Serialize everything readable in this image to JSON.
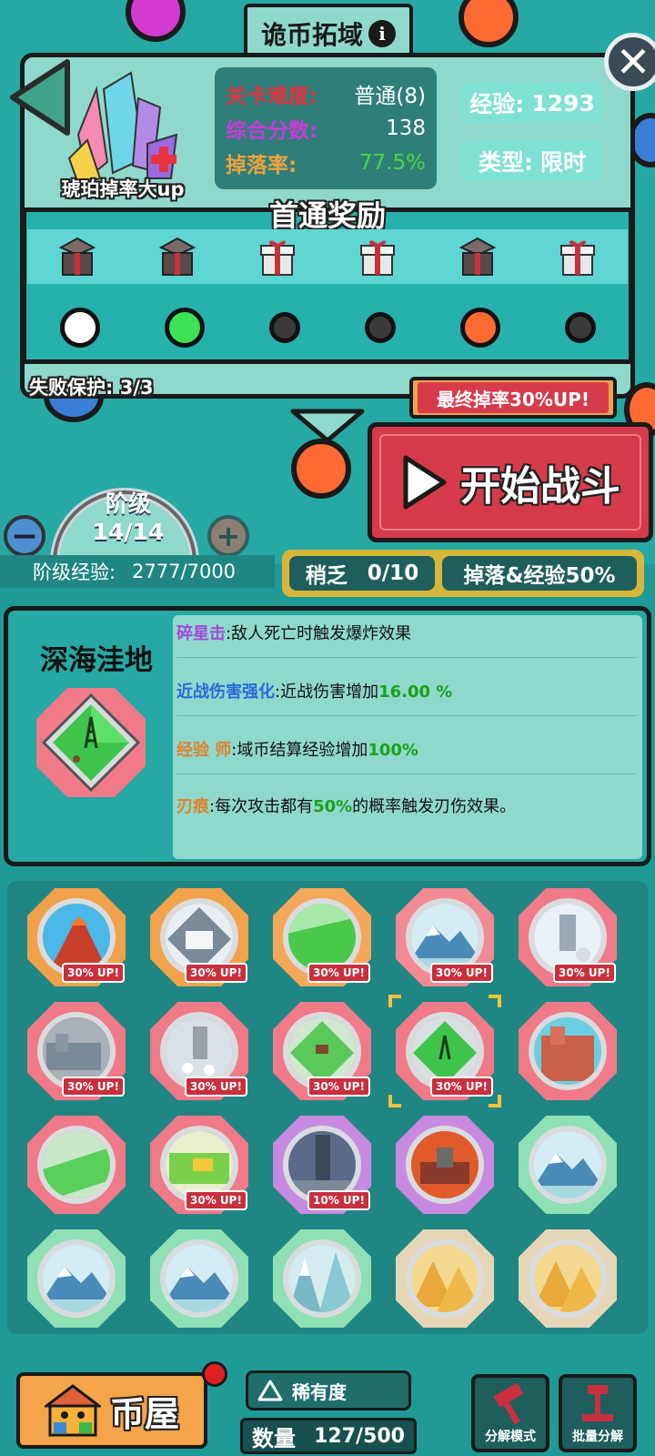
{
  "title": "诡币拓域",
  "amber_label": "琥珀掉率大up",
  "stats": [
    {
      "key": "关卡难度:",
      "value": "普通(8)",
      "key_color": "#e8323c",
      "value_color": "#ffffff"
    },
    {
      "key": "综合分数:",
      "value": "138",
      "key_color": "#c83bd8",
      "value_color": "#ffffff"
    },
    {
      "key": "掉落率:",
      "value": "77.5%",
      "key_color": "#f0a23a",
      "value_color": "#4cd83a"
    }
  ],
  "exp_chip": {
    "label": "经验:",
    "value": "1293"
  },
  "type_chip": {
    "label": "类型:",
    "value": "限时"
  },
  "reward_title": "首通奖励",
  "reward_icons": [
    "open-box",
    "open-box",
    "gift-box",
    "gift-box",
    "open-box",
    "gift-box"
  ],
  "reward_dots": [
    {
      "color": "#ffffff",
      "size": 44
    },
    {
      "color": "#3de356",
      "size": 44
    },
    {
      "color": "#3a3a3a",
      "size": 34
    },
    {
      "color": "#3a3a3a",
      "size": 34
    },
    {
      "color": "#ff6a33",
      "size": 44
    },
    {
      "color": "#3a3a3a",
      "size": 34
    }
  ],
  "fail_protect": "失败保护: 3/3",
  "drop_up_tag": "最终掉率30%UP!",
  "start_button": "开始战斗",
  "tier": {
    "label": "阶级",
    "value": "14/14",
    "minus": "−",
    "plus": "+"
  },
  "tier_exp": {
    "label": "阶级经验:",
    "value": "2777/7000"
  },
  "status": {
    "scarcity": "稍乏",
    "progress": "0/10",
    "bonus": "掉落&经验50%"
  },
  "map": {
    "name": "深海洼地"
  },
  "modifiers": [
    {
      "key": "碎星击",
      "key_color": "#a04cd8",
      "text": ":敌人死亡时触发爆炸效果",
      "green": "",
      "tail": ""
    },
    {
      "key": "近战伤害强化",
      "key_color": "#2a6ad8",
      "text": ":近战伤害增加",
      "green": "16.00 %",
      "tail": ""
    },
    {
      "key": "经验 师",
      "key_color": "#e0822a",
      "text": ":域币结算经验增加",
      "green": "100%",
      "tail": ""
    },
    {
      "key": "刃痕",
      "key_color": "#e0822a",
      "text": ":每次攻击都有",
      "green": "50%",
      "tail": "的概率触发刃伤效果。"
    }
  ],
  "tiles": [
    {
      "frame": "#f0a24a",
      "scene": "volcano",
      "badge": "30% UP!"
    },
    {
      "frame": "#f2a24a",
      "scene": "ice-diamond",
      "badge": "30% UP!"
    },
    {
      "frame": "#f5a75a",
      "scene": "grass-field",
      "badge": "30% UP!"
    },
    {
      "frame": "#f28a94",
      "scene": "snow-mountain",
      "badge": "30% UP!"
    },
    {
      "frame": "#f07a88",
      "scene": "snow-castle",
      "badge": "30% UP!"
    },
    {
      "frame": "#f07a88",
      "scene": "grey-town",
      "badge": "30% UP!"
    },
    {
      "frame": "#f07a88",
      "scene": "snow-tower",
      "badge": "30% UP!"
    },
    {
      "frame": "#f07a88",
      "scene": "grass-diamond",
      "badge": "30% UP!"
    },
    {
      "frame": "#f07a88",
      "scene": "deep-sea-diamond",
      "badge": "30% UP!",
      "selected": true
    },
    {
      "frame": "#f07a88",
      "scene": "red-canyon",
      "badge": ""
    },
    {
      "frame": "#f07a88",
      "scene": "green-path",
      "badge": ""
    },
    {
      "frame": "#f07a88",
      "scene": "farm",
      "badge": "30% UP!"
    },
    {
      "frame": "#c88ae0",
      "scene": "dark-tower",
      "badge": "10% UP!"
    },
    {
      "frame": "#c88ae0",
      "scene": "lava-castle",
      "badge": ""
    },
    {
      "frame": "#8fe0b4",
      "scene": "snow-mountain",
      "badge": ""
    },
    {
      "frame": "#8fe0b4",
      "scene": "snow-mountain",
      "badge": ""
    },
    {
      "frame": "#8fe0b4",
      "scene": "snow-mountain",
      "badge": ""
    },
    {
      "frame": "#8fe0b4",
      "scene": "ice-peaks",
      "badge": ""
    },
    {
      "frame": "#e6d6b8",
      "scene": "desert-pyramids",
      "badge": ""
    },
    {
      "frame": "#e6d6b8",
      "scene": "desert-pyramids",
      "badge": ""
    }
  ],
  "bottom": {
    "coin_house": "币屋",
    "rarity": "稀有度",
    "count_label": "数量",
    "count_value": "127/500",
    "decompose_mode": "分解模式",
    "batch_decompose": "批量分解"
  },
  "colors": {
    "accent_red": "#d63b4b",
    "panel_mint": "#8fd8cc",
    "bg_teal": "#1f9a96"
  }
}
